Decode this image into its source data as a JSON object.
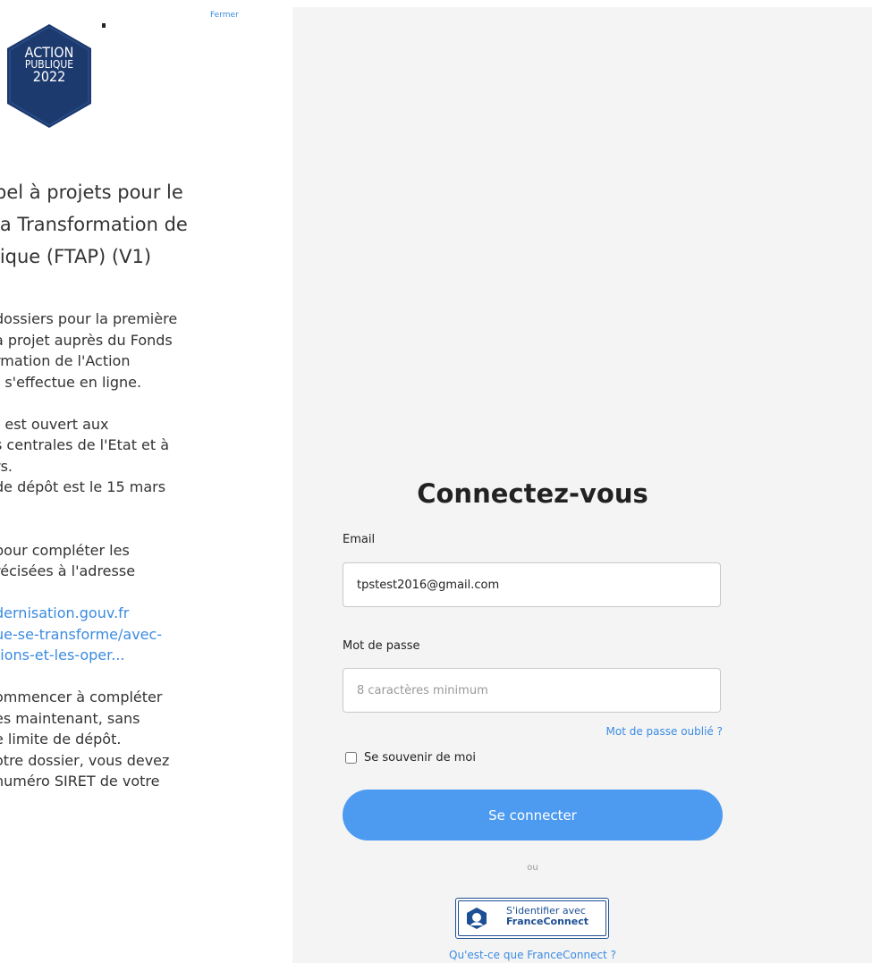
{
  "close_label": "Fermer",
  "logo": {
    "line1": "ACTION",
    "line2": "PUBLIQUE",
    "line3": "2022"
  },
  "procedure_title": "pel à projets pour le\nla Transformation de\nlique (FTAP) (V1)",
  "description": {
    "text1": "dossiers pour la première\nà projet auprès du Fonds\nrmation de l'Action\n) s'effectue en ligne.\n\nt est ouvert aux\ns centrales de l'Etat et à\nrs.\nde dépôt est le 15 mars\n\n\npour compléter les\nrécisées à l'adresse\n\n",
    "link": "dernisation.gouv.fr\nue-se-transforme/avec-\ntions-et-les-oper...",
    "text2": "\n\nommencer à compléter\nès maintenant, sans\ne limite de dépôt.\notre dossier, vous devez\nnuméro SIRET de votre"
  },
  "login": {
    "title": "Connectez-vous",
    "email_label": "Email",
    "email_value": "tpstest2016@gmail.com",
    "password_label": "Mot de passe",
    "password_placeholder": "8 caractères minimum",
    "forgot_password": "Mot de passe oublié ?",
    "remember_me": "Se souvenir de moi",
    "submit_label": "Se connecter",
    "or_label": "ou",
    "franceconnect_line1": "S'identifier avec",
    "franceconnect_line2": "FranceConnect",
    "franceconnect_help": "Qu'est-ce que FranceConnect ?"
  },
  "colors": {
    "link": "#3b8be0",
    "button": "#4d9bf0",
    "right_bg": "#f4f4f5",
    "logo_hex": "#1d3a6e",
    "franceconnect": "#1c4f93"
  }
}
